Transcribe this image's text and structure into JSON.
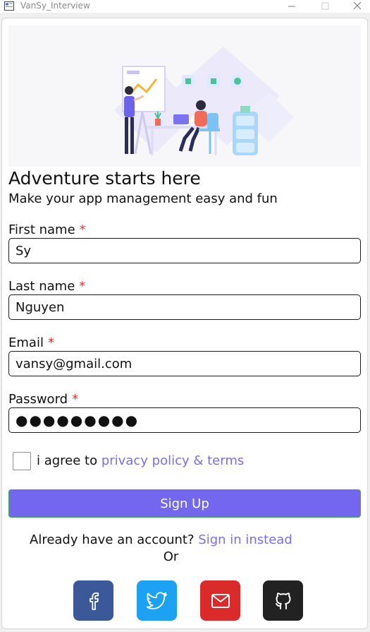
{
  "window": {
    "title": "VanSy_Interview"
  },
  "hero": {
    "image_name": "register-illustration"
  },
  "heading": "Adventure starts here",
  "subheading": "Make your app management easy and fun",
  "form": {
    "first_name": {
      "label": "First name",
      "required_mark": "*",
      "value": "Sy"
    },
    "last_name": {
      "label": "Last name",
      "required_mark": "*",
      "value": "Nguyen"
    },
    "email": {
      "label": "Email",
      "required_mark": "*",
      "value": "vansy@gmail.com"
    },
    "password": {
      "label": "Password",
      "required_mark": "*",
      "value": "●●●●●●●●●"
    },
    "agree": {
      "checked": false,
      "prefix": "i agree to ",
      "link": "privacy policy & terms"
    },
    "submit_label": "Sign Up"
  },
  "signin": {
    "prompt": "Already have an account? ",
    "link": "Sign in instead"
  },
  "or_text": "Or",
  "social": [
    {
      "name": "facebook-icon",
      "color": "#3b5998"
    },
    {
      "name": "twitter-icon",
      "color": "#1da1f2"
    },
    {
      "name": "mail-icon",
      "color": "#db2a2a"
    },
    {
      "name": "github-icon",
      "color": "#222222"
    }
  ],
  "colors": {
    "accent": "#7367f0",
    "link": "#7b6ee8",
    "required": "#e0322e"
  }
}
